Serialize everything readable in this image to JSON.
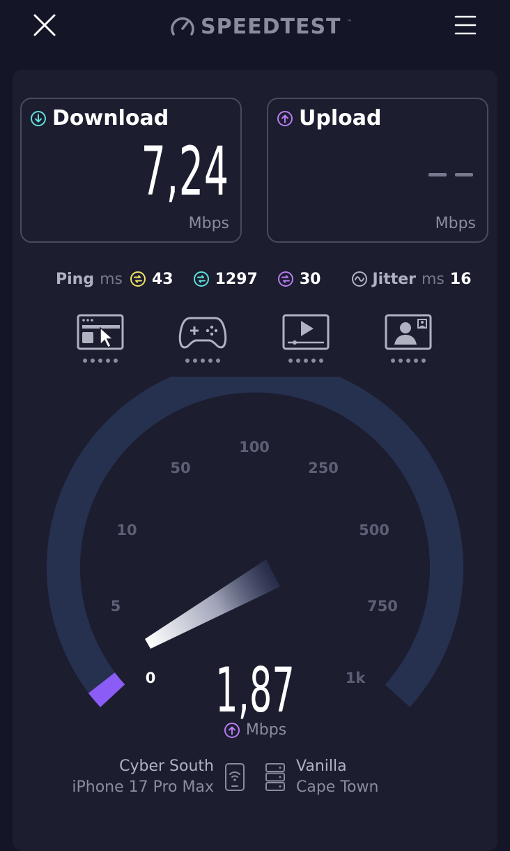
{
  "app": {
    "title": "SPEEDTEST"
  },
  "icons": {
    "close": "close-icon",
    "menu": "hamburger-menu-icon",
    "logo": "speedometer-icon"
  },
  "colors": {
    "background": "#141526",
    "panel": "#1c1d2f",
    "gauge_track": "#26304f",
    "accent_purple": "#8b5cf6",
    "download_cyan": "#5ee0dc",
    "ping_yellow": "#f2e267"
  },
  "download": {
    "label": "Download",
    "value": "7,24",
    "unit": "Mbps"
  },
  "upload": {
    "label": "Upload",
    "value": "- -",
    "unit": "Mbps"
  },
  "ping": {
    "label": "Ping",
    "unit": "ms",
    "idle": "43",
    "download": "1297",
    "upload": "30"
  },
  "jitter": {
    "label": "Jitter",
    "unit": "ms",
    "value": "16"
  },
  "activities": [
    {
      "name": "web-browsing-icon",
      "rating_dots": 5
    },
    {
      "name": "gaming-icon",
      "rating_dots": 5
    },
    {
      "name": "video-streaming-icon",
      "rating_dots": 5
    },
    {
      "name": "video-call-icon",
      "rating_dots": 5
    }
  ],
  "gauge": {
    "ticks": [
      "0",
      "5",
      "10",
      "50",
      "100",
      "250",
      "500",
      "750",
      "1k"
    ],
    "current_value": "1,87",
    "unit": "Mbps",
    "phase": "upload"
  },
  "connection": {
    "isp": "Cyber South",
    "device": "iPhone 17 Pro Max",
    "server_name": "Vanilla",
    "server_location": "Cape Town"
  }
}
